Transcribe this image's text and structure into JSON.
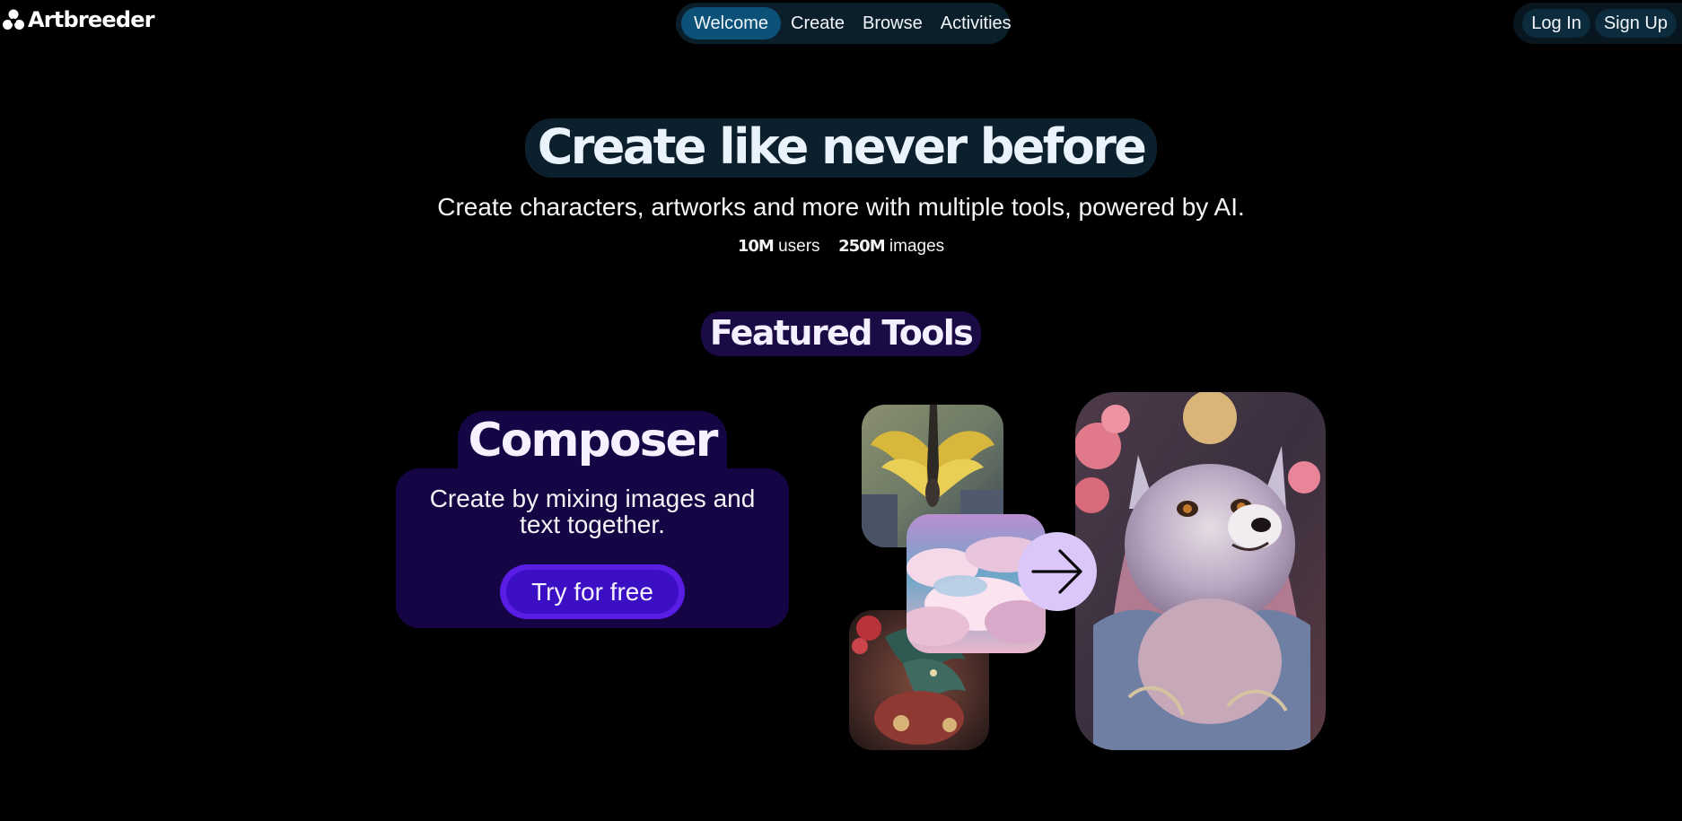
{
  "brand": {
    "name": "Artbreeder"
  },
  "nav": {
    "items": [
      {
        "label": "Welcome",
        "active": true
      },
      {
        "label": "Create",
        "active": false
      },
      {
        "label": "Browse",
        "active": false
      },
      {
        "label": "Activities",
        "active": false
      }
    ]
  },
  "auth": {
    "login_label": "Log In",
    "signup_label": "Sign Up"
  },
  "hero": {
    "title": "Create like never before",
    "subtitle": "Create characters, artworks and more with multiple tools, powered by AI.",
    "stats": [
      {
        "value": "10M",
        "label": "users"
      },
      {
        "value": "250M",
        "label": "images"
      }
    ]
  },
  "featured": {
    "heading": "Featured Tools",
    "tools": [
      {
        "name": "Composer",
        "description": "Create by mixing images and text together.",
        "cta_label": "Try for free",
        "icon": "arrow-right-icon"
      }
    ]
  },
  "colors": {
    "background": "#000000",
    "nav_bg": "#0b1f2b",
    "nav_active": "#0b5178",
    "card_bg": "#150545",
    "cta_outer": "#5a1de6",
    "cta_inner": "#3d0fc4",
    "arrow_circle": "#dcc7fb"
  }
}
